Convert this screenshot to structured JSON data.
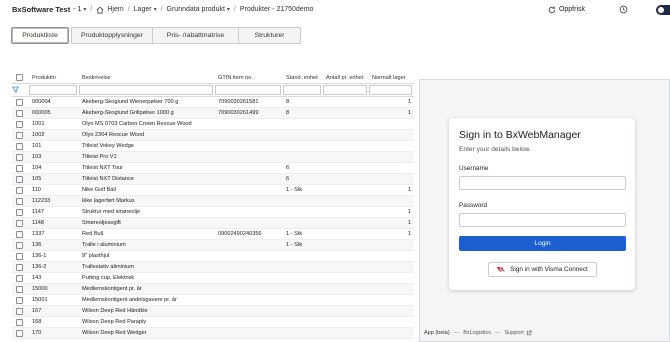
{
  "topbar": {
    "company": "BxSoftware Test",
    "company_num": "- 1",
    "crumbs": [
      "Hjem",
      "Lager",
      "Grunndata produkt",
      "Produkter - 21750demo"
    ],
    "refresh": "Oppfrisk"
  },
  "tabs": [
    "Produktliste",
    "Produktopplysninger",
    "Pris- /rabattmatrise",
    "Strukturer"
  ],
  "table": {
    "headers": [
      "Produktnr",
      "Beskrivelse",
      "GTIN item no.",
      "Stand. enhet",
      "Antall pr. enhet",
      "Normalt lager"
    ],
    "rows": [
      [
        "000004",
        "Åkeberg-Skoglund Wienerpølser 700 g",
        "7090030261581",
        "8",
        "",
        "1"
      ],
      [
        "000005",
        "Åkeberg-Skoglund Grillpølser 1000 g",
        "7090030261499",
        "8",
        "",
        "1"
      ],
      [
        "1001",
        "Olyo MS 0703 Carbon Crown Rescue Wood",
        "",
        "",
        "",
        ""
      ],
      [
        "1002",
        "Olyo 2304 Rescue Wood",
        "",
        "",
        "",
        ""
      ],
      [
        "101",
        "Titleist Vokey Wedge",
        "",
        "",
        "",
        ""
      ],
      [
        "103",
        "Titleist Pro V1",
        "",
        "",
        "",
        ""
      ],
      [
        "104",
        "Titleist NXT Tour",
        "",
        "6",
        "",
        ""
      ],
      [
        "105",
        "Titleist NXT Distance",
        "",
        "6",
        "",
        ""
      ],
      [
        "110",
        "Nike Golf Ball",
        "",
        "1 - Stk",
        "",
        "1"
      ],
      [
        "112233",
        "Ikke lagerført Markus",
        "",
        "",
        "",
        ""
      ],
      [
        "1147",
        "Struktur med smøreolje",
        "",
        "",
        "",
        "1"
      ],
      [
        "1148",
        "Smøreoljeavgift",
        "",
        "",
        "",
        "1"
      ],
      [
        "1337",
        "Red Bull",
        "09002490240356",
        "1 - Stk",
        "",
        "1"
      ],
      [
        "136",
        "Tralle i aluminium",
        "",
        "1 - Stk",
        "",
        ""
      ],
      [
        "136-1",
        "9\" plasthjul",
        "",
        "",
        "",
        ""
      ],
      [
        "136-2",
        "Trallestativ aliminium",
        "",
        "",
        "",
        ""
      ],
      [
        "143",
        "Putting cup, Elektrisk",
        "",
        "",
        "",
        ""
      ],
      [
        "15000",
        "Medlemskontigent pr. år",
        "",
        "",
        "",
        ""
      ],
      [
        "15001",
        "Medlemskontigent andelsgavere pr. år",
        "",
        "",
        "",
        ""
      ],
      [
        "167",
        "Wilson Deep Red Håndkle",
        "",
        "",
        "",
        ""
      ],
      [
        "168",
        "Wilson Deep Red Paraply",
        "",
        "",
        "",
        ""
      ],
      [
        "170",
        "Wilson Deep Red Wedger",
        "",
        "",
        "",
        ""
      ]
    ]
  },
  "login": {
    "title": "Sign in to BxWebManager",
    "subtitle": "Enter your details below.",
    "username_label": "Username",
    "password_label": "Password",
    "login_button": "Login",
    "visma_button": "Sign in with Visma Connect",
    "footer_app": "App (beta)",
    "footer_logistics": "BxLogistics",
    "footer_support": "Support"
  },
  "colors": {
    "primary": "#1b5fd1",
    "visma": "#d4202a"
  }
}
